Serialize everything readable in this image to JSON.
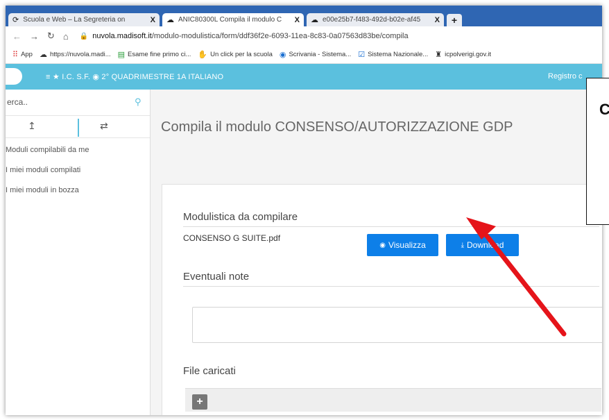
{
  "browser": {
    "tabs": [
      {
        "icon": "chrome-logo-icon",
        "label": "Scuola e Web – La Segreteria on"
      },
      {
        "icon": "cloud-icon",
        "label": "ANIC80300L Compila il modulo C"
      },
      {
        "icon": "cloud-icon",
        "label": "e00e25b7-f483-492d-b02e-af45"
      }
    ],
    "new_tab": "+",
    "close": "X",
    "url_host": "nuvola.madisoft.it",
    "url_path": "/modulo-modulistica/form/ddf36f2e-6093-11ea-8c83-0a07563d83be/compila",
    "bookmarks": [
      {
        "icon": "apps-grid-icon",
        "label": "App"
      },
      {
        "icon": "cloud-icon",
        "label": "https://nuvola.madi..."
      },
      {
        "icon": "document-icon",
        "label": "Esame fine primo ci..."
      },
      {
        "icon": "hand-icon",
        "label": "Un click per la scuola"
      },
      {
        "icon": "globe-icon",
        "label": "Scrivania - Sistema..."
      },
      {
        "icon": "check-icon",
        "label": "Sistema Nazionale..."
      },
      {
        "icon": "school-icon",
        "label": "icpolverigi.gov.it"
      }
    ]
  },
  "app": {
    "header_nav": "≡ ★ I.C. S.F. ◉ 2° QUADRIMESTRE  1A  ITALIANO",
    "header_right": "Registro c",
    "sidebar": {
      "search_placeholder": "erca..",
      "menu": [
        "Moduli compilabili da me",
        "I miei moduli compilati",
        "I miei moduli in bozza"
      ]
    },
    "page_title": "Compila il modulo CONSENSO/AUTORIZZAZIONE GDP",
    "section_modulistica": "Modulistica da compilare",
    "file_name": "CONSENSO G SUITE.pdf",
    "btn_visualizza": "Visualizza",
    "btn_download": "Download",
    "section_note": "Eventuali note",
    "section_files": "File caricati",
    "add_label": "+"
  },
  "annotation": {
    "callout_letter": "C",
    "arrow_color": "#e5141a"
  }
}
